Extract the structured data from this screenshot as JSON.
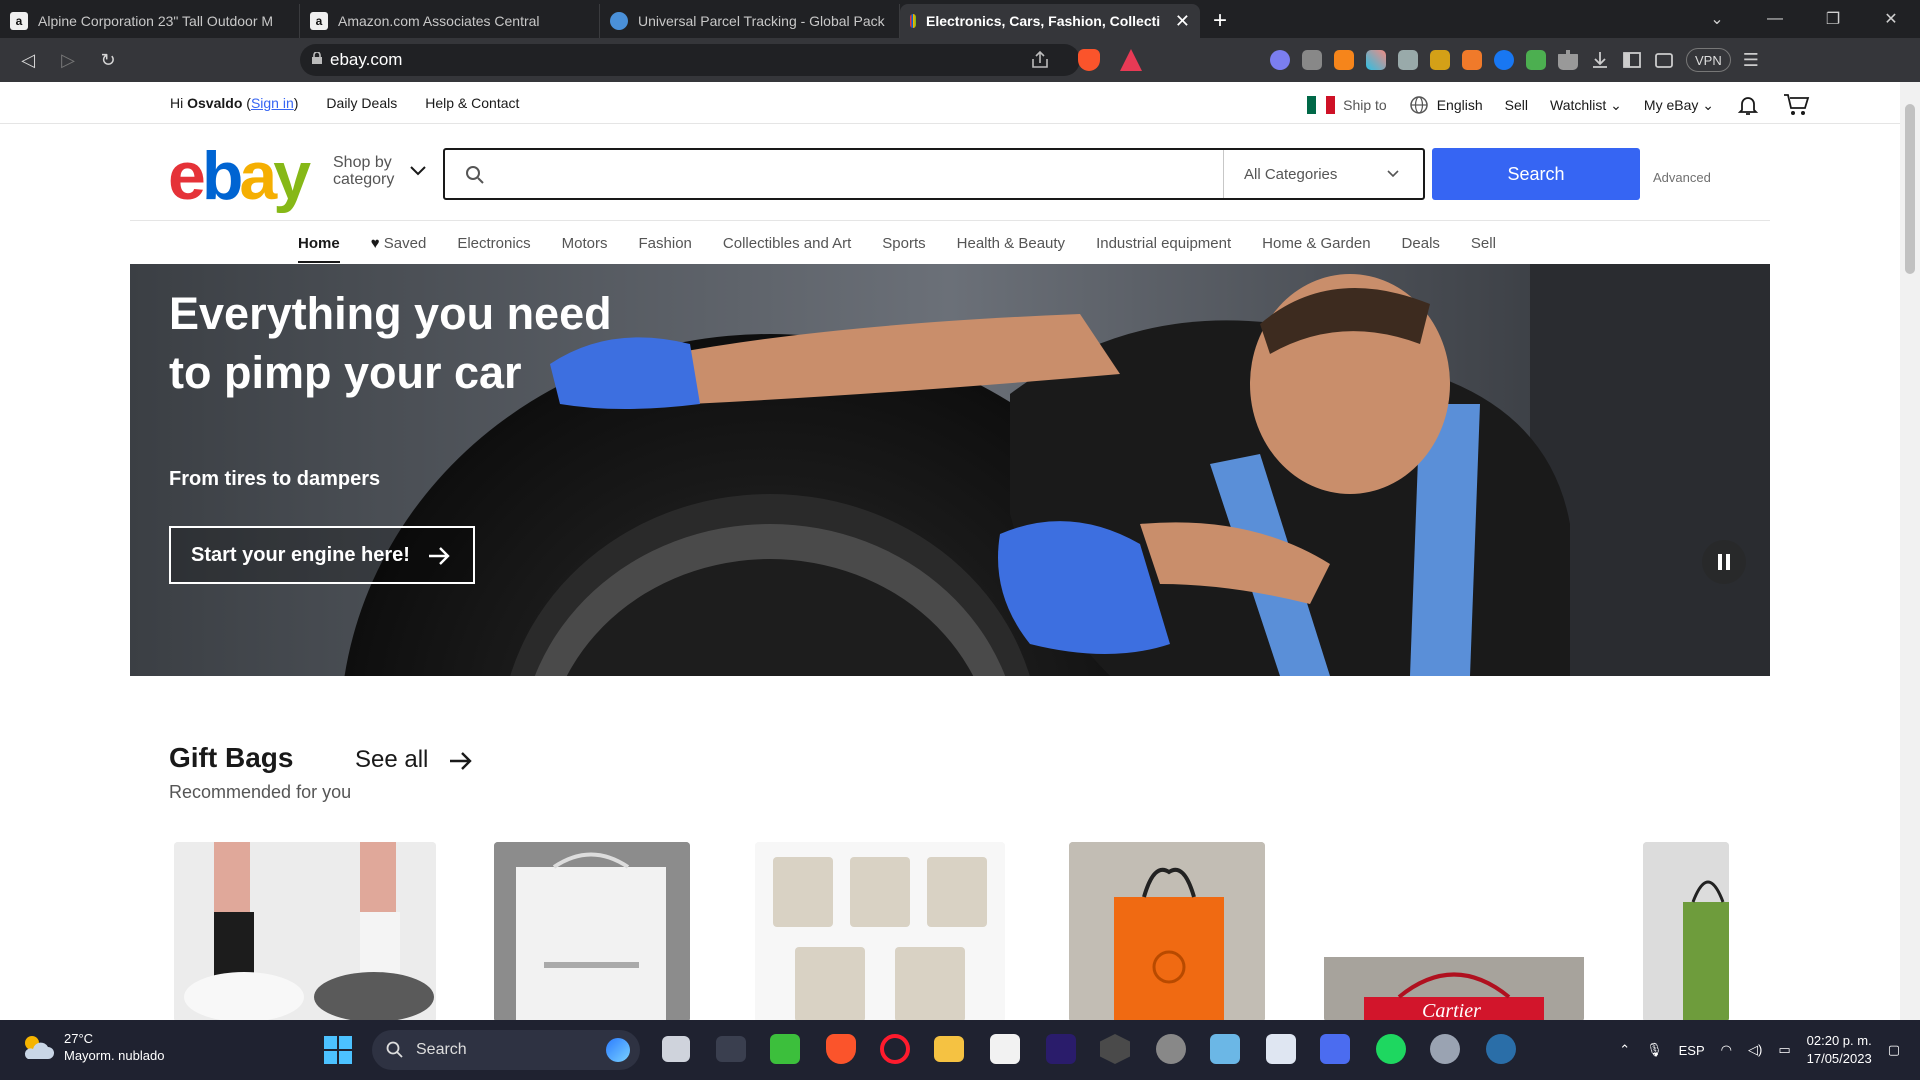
{
  "browser": {
    "tabs": [
      {
        "title": "Alpine Corporation 23\" Tall Outdoor M",
        "favicon_color": "#f0f0f0",
        "favicon_glyph": "a",
        "active": false
      },
      {
        "title": "Amazon.com Associates Central",
        "favicon_color": "#f0f0f0",
        "favicon_glyph": "a",
        "active": false
      },
      {
        "title": "Universal Parcel Tracking - Global Pack",
        "favicon_color": "#4a90d9",
        "favicon_glyph": "",
        "active": false
      },
      {
        "title": "Electronics, Cars, Fashion, Collecti",
        "favicon_color": "#e53238",
        "favicon_glyph": "",
        "active": true
      }
    ],
    "new_tab": "+",
    "url": "ebay.com",
    "vpn_label": "VPN"
  },
  "ebay": {
    "topnav": {
      "greeting": "Hi",
      "user": "Osvaldo",
      "signin": "Sign in",
      "links": [
        "Daily Deals",
        "Help & Contact"
      ],
      "ship_to": "Ship to",
      "language": "English",
      "sell": "Sell",
      "watchlist": "Watchlist",
      "my_ebay": "My eBay"
    },
    "logo_letters": [
      "e",
      "b",
      "a",
      "y"
    ],
    "logo_colors": [
      "#e53238",
      "#0064d2",
      "#f5af02",
      "#86b817"
    ],
    "shop_by": [
      "Shop by",
      "category"
    ],
    "search": {
      "value": "",
      "category": "All Categories",
      "button": "Search",
      "advanced": "Advanced"
    },
    "categories": [
      "Home",
      "Saved",
      "Electronics",
      "Motors",
      "Fashion",
      "Collectibles and Art",
      "Sports",
      "Health & Beauty",
      "Industrial equipment",
      "Home & Garden",
      "Deals",
      "Sell"
    ],
    "hero": {
      "title": "Everything you need to pimp your car",
      "subtitle": "From tires to dampers",
      "cta": "Start your engine here!"
    },
    "section": {
      "title": "Gift Bags",
      "see_all": "See all",
      "subtitle": "Recommended for you"
    },
    "cards": [
      {
        "name": "socks-sandals"
      },
      {
        "name": "white-gift-bag"
      },
      {
        "name": "dust-bags"
      },
      {
        "name": "orange-gift-bag"
      },
      {
        "name": "red-gift-bag",
        "label": "Cartier"
      },
      {
        "name": "green-gift-bag"
      }
    ]
  },
  "taskbar": {
    "temperature": "27°C",
    "weather": "Mayorm. nublado",
    "search": "Search",
    "language": "ESP",
    "time": "02:20 p. m.",
    "date": "17/05/2023"
  }
}
